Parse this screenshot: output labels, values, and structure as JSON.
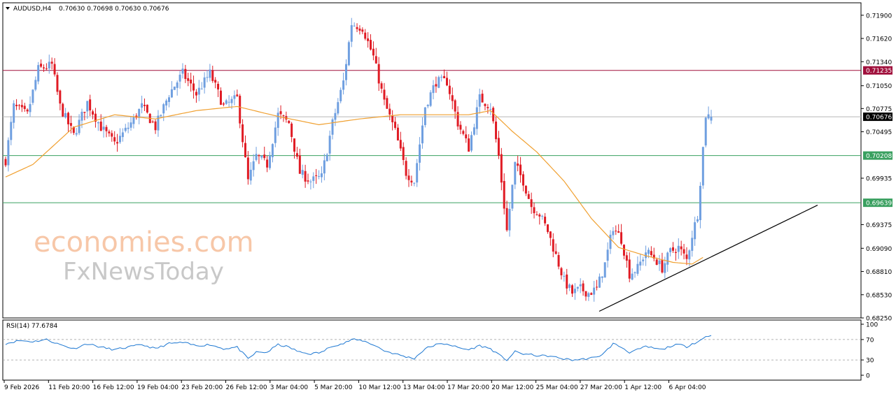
{
  "header": {
    "symbol": "AUDUSD,H4",
    "ohlc": "0.70630 0.70698 0.70630 0.70676"
  },
  "rsi_header": "RSI(14) 77.6784",
  "watermark": {
    "line1": "economies.com",
    "line2": "FxNewsToday"
  },
  "colors": {
    "bull": "#6f9fe0",
    "bear": "#e01b24",
    "ma": "#f0a030",
    "rsi": "#1e78d2",
    "resistance": "#a0103c",
    "support": "#3aa060",
    "current": "#000000",
    "trend": "#000000"
  },
  "chart_data": [
    {
      "type": "candlestick",
      "symbol": "AUDUSD",
      "timeframe": "H4",
      "ylim": [
        0.6825,
        0.7205
      ],
      "y_ticks": [
        "0.71900",
        "0.71620",
        "0.71340",
        "0.71050",
        "0.70775",
        "0.70495",
        "0.69935",
        "0.69375",
        "0.69090",
        "0.68810",
        "0.68530",
        "0.68250"
      ],
      "x_ticks": [
        "9 Feb 2026",
        "11 Feb 20:00",
        "16 Feb 12:00",
        "19 Feb 04:00",
        "23 Feb 20:00",
        "26 Feb 12:00",
        "3 Mar 04:00",
        "5 Mar 20:00",
        "10 Mar 12:00",
        "13 Mar 04:00",
        "17 Mar 20:00",
        "20 Mar 12:00",
        "25 Mar 04:00",
        "27 Mar 20:00",
        "1 Apr 12:00",
        "6 Apr 04:00"
      ],
      "price_levels": [
        {
          "name": "resistance",
          "value": 0.71235,
          "label": "0.71235",
          "color": "#a0103c"
        },
        {
          "name": "current",
          "value": 0.70676,
          "label": "0.70676",
          "color": "#000000"
        },
        {
          "name": "support-1",
          "value": 0.70208,
          "label": "0.70208",
          "color": "#3aa060"
        },
        {
          "name": "support-2",
          "value": 0.69639,
          "label": "0.69639",
          "color": "#3aa060"
        }
      ],
      "trendline": {
        "start": [
          0,
          0.6833
        ],
        "end": [
          1,
          0.6961
        ]
      },
      "series": [
        {
          "name": "price",
          "anchors": [
            [
              0,
              0.7015
            ],
            [
              3,
              0.708
            ],
            [
              8,
              0.707
            ],
            [
              12,
              0.7125
            ],
            [
              17,
              0.713
            ],
            [
              20,
              0.708
            ],
            [
              25,
              0.7045
            ],
            [
              30,
              0.7085
            ],
            [
              35,
              0.7055
            ],
            [
              40,
              0.7035
            ],
            [
              45,
              0.7055
            ],
            [
              50,
              0.708
            ],
            [
              55,
              0.7055
            ],
            [
              60,
              0.7095
            ],
            [
              65,
              0.712
            ],
            [
              70,
              0.7095
            ],
            [
              75,
              0.712
            ],
            [
              80,
              0.708
            ],
            [
              85,
              0.709
            ],
            [
              89,
              0.699
            ],
            [
              92,
              0.702
            ],
            [
              96,
              0.701
            ],
            [
              100,
              0.707
            ],
            [
              104,
              0.706
            ],
            [
              108,
              0.7
            ],
            [
              112,
              0.699
            ],
            [
              116,
              0.6995
            ],
            [
              120,
              0.706
            ],
            [
              124,
              0.711
            ],
            [
              127,
              0.718
            ],
            [
              131,
              0.7175
            ],
            [
              135,
              0.714
            ],
            [
              139,
              0.7085
            ],
            [
              143,
              0.705
            ],
            [
              147,
              0.7
            ],
            [
              150,
              0.699
            ],
            [
              154,
              0.708
            ],
            [
              158,
              0.711
            ],
            [
              162,
              0.711
            ],
            [
              166,
              0.706
            ],
            [
              170,
              0.703
            ],
            [
              174,
              0.709
            ],
            [
              178,
              0.708
            ],
            [
              181,
              0.702
            ],
            [
              184,
              0.693
            ],
            [
              187,
              0.701
            ],
            [
              190,
              0.699
            ],
            [
              193,
              0.696
            ],
            [
              196,
              0.695
            ],
            [
              199,
              0.693
            ],
            [
              202,
              0.69
            ],
            [
              205,
              0.687
            ],
            [
              208,
              0.6855
            ],
            [
              211,
              0.686
            ],
            [
              214,
              0.6855
            ],
            [
              217,
              0.686
            ],
            [
              220,
              0.689
            ],
            [
              223,
              0.6935
            ],
            [
              226,
              0.692
            ],
            [
              229,
              0.6878
            ],
            [
              232,
              0.6885
            ],
            [
              235,
              0.6905
            ],
            [
              238,
              0.6898
            ],
            [
              241,
              0.6885
            ],
            [
              244,
              0.6905
            ],
            [
              247,
              0.691
            ],
            [
              250,
              0.6895
            ],
            [
              252,
              0.6925
            ],
            [
              254,
              0.695
            ],
            [
              256,
              0.703
            ],
            [
              257,
              0.707
            ],
            [
              259,
              0.70676
            ]
          ]
        },
        {
          "name": "MA",
          "anchors": [
            [
              0,
              0.6995
            ],
            [
              10,
              0.701
            ],
            [
              25,
              0.7055
            ],
            [
              40,
              0.707
            ],
            [
              55,
              0.7065
            ],
            [
              70,
              0.7075
            ],
            [
              85,
              0.708
            ],
            [
              100,
              0.7068
            ],
            [
              115,
              0.7058
            ],
            [
              130,
              0.7065
            ],
            [
              145,
              0.707
            ],
            [
              160,
              0.707
            ],
            [
              170,
              0.707
            ],
            [
              178,
              0.7075
            ],
            [
              186,
              0.705
            ],
            [
              195,
              0.7025
            ],
            [
              205,
              0.699
            ],
            [
              215,
              0.6945
            ],
            [
              225,
              0.691
            ],
            [
              235,
              0.69
            ],
            [
              245,
              0.6892
            ],
            [
              252,
              0.689
            ],
            [
              256,
              0.6898
            ]
          ]
        }
      ]
    },
    {
      "type": "line",
      "name": "RSI(14) 77.6784",
      "ylim": [
        0,
        100
      ],
      "y_ticks": [
        "100",
        "70",
        "30",
        "0"
      ],
      "levels": [
        70,
        30
      ],
      "series": [
        {
          "name": "RSI(14)",
          "anchors": [
            [
              0,
              62
            ],
            [
              5,
              68
            ],
            [
              10,
              66
            ],
            [
              15,
              70
            ],
            [
              20,
              60
            ],
            [
              25,
              52
            ],
            [
              30,
              62
            ],
            [
              35,
              55
            ],
            [
              40,
              50
            ],
            [
              45,
              55
            ],
            [
              50,
              60
            ],
            [
              55,
              52
            ],
            [
              60,
              62
            ],
            [
              65,
              64
            ],
            [
              70,
              58
            ],
            [
              75,
              60
            ],
            [
              80,
              52
            ],
            [
              85,
              55
            ],
            [
              89,
              32
            ],
            [
              92,
              45
            ],
            [
              96,
              45
            ],
            [
              100,
              60
            ],
            [
              104,
              55
            ],
            [
              108,
              45
            ],
            [
              112,
              42
            ],
            [
              116,
              45
            ],
            [
              120,
              58
            ],
            [
              124,
              62
            ],
            [
              127,
              70
            ],
            [
              131,
              68
            ],
            [
              135,
              60
            ],
            [
              139,
              48
            ],
            [
              143,
              42
            ],
            [
              147,
              36
            ],
            [
              150,
              33
            ],
            [
              154,
              52
            ],
            [
              158,
              60
            ],
            [
              162,
              62
            ],
            [
              166,
              54
            ],
            [
              170,
              50
            ],
            [
              174,
              58
            ],
            [
              178,
              52
            ],
            [
              181,
              40
            ],
            [
              184,
              30
            ],
            [
              187,
              46
            ],
            [
              190,
              42
            ],
            [
              193,
              40
            ],
            [
              196,
              38
            ],
            [
              199,
              38
            ],
            [
              202,
              35
            ],
            [
              205,
              32
            ],
            [
              208,
              30
            ],
            [
              211,
              31
            ],
            [
              214,
              33
            ],
            [
              217,
              35
            ],
            [
              220,
              45
            ],
            [
              223,
              62
            ],
            [
              226,
              55
            ],
            [
              229,
              45
            ],
            [
              232,
              50
            ],
            [
              235,
              56
            ],
            [
              238,
              53
            ],
            [
              241,
              50
            ],
            [
              244,
              57
            ],
            [
              247,
              60
            ],
            [
              250,
              56
            ],
            [
              252,
              62
            ],
            [
              254,
              65
            ],
            [
              256,
              72
            ],
            [
              257,
              76
            ],
            [
              259,
              78
            ]
          ]
        }
      ]
    }
  ]
}
